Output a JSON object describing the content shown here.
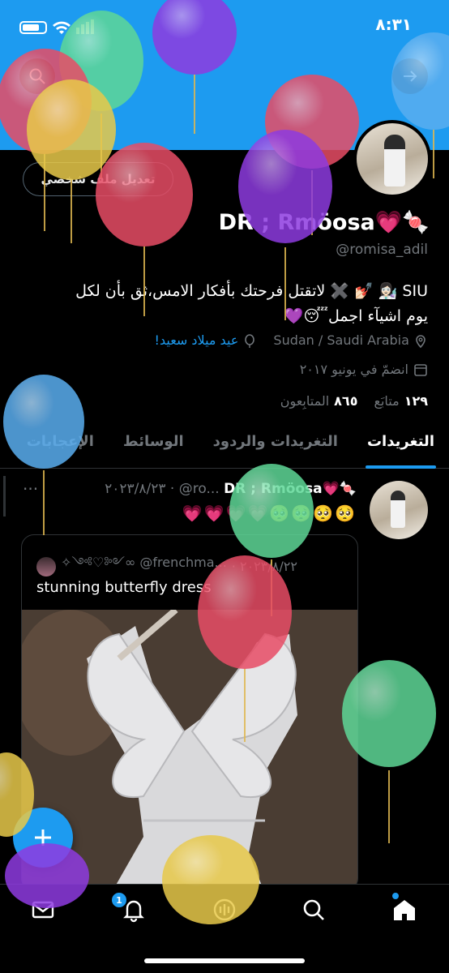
{
  "status_bar": {
    "time": "٨:٣١"
  },
  "profile": {
    "edit_button": "تعديل ملف شخصي",
    "display_name": "DR ; Rmöosa💗🍬",
    "handle": "@romisa_adil",
    "bio_line1": "SIU 👩🏻‍🔬 💅🏻 ✖️ لاتقتل فرحتك بأفكار الامس،ثق بأن لكل",
    "bio_line2": "يوم اشيآء اجمل😴💜",
    "location": "Sudan / Saudi Arabia",
    "birthday": "عيد ميلاد سعيد!",
    "joined": "انضمّ في يونيو ٢٠١٧",
    "following_count": "١٢٩",
    "following_label": "متابَع",
    "followers_count": "٨٦٥",
    "followers_label": "المتابِعون"
  },
  "tabs": [
    {
      "label": "التغريدات"
    },
    {
      "label": "التغريدات والردود"
    },
    {
      "label": "الوسائط"
    },
    {
      "label": "الإعجابات"
    }
  ],
  "tweet": {
    "name": "DR ; Rmöosa💗🍬",
    "meta": "٢٠٢٣/٨/٢٣ · @ro...",
    "more": "···",
    "body": "💗💗💗💗🥺🥺🥺🥺",
    "quote": {
      "handle": "✧༺♡༻∞ @frenchma...",
      "date": "· ٢٠٢٣/٨/٢٢",
      "text": "stunning butterfly dress"
    }
  },
  "nav": {
    "notification_badge": "1"
  },
  "colors": {
    "accent": "#1d9bf0",
    "background": "#000000",
    "muted": "#71767b"
  },
  "icons": [
    "search-icon",
    "back-arrow-icon",
    "location-icon",
    "balloon-icon",
    "calendar-icon",
    "mail-icon",
    "bell-icon",
    "spaces-icon",
    "search-nav-icon",
    "home-icon",
    "compose-plus-icon"
  ]
}
